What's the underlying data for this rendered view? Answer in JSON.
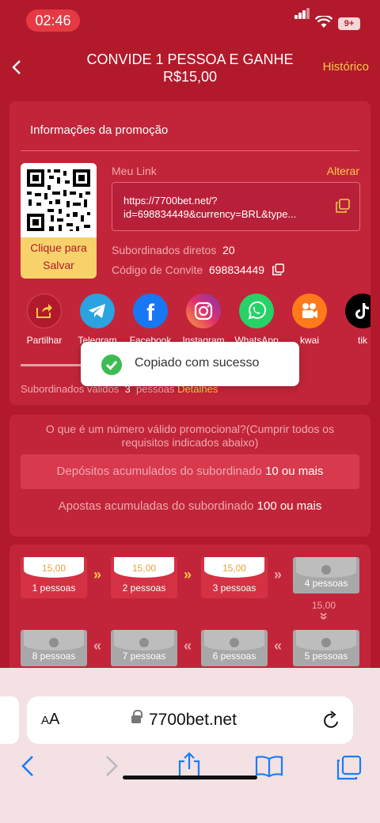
{
  "status": {
    "time": "02:46",
    "battery": "9+"
  },
  "header": {
    "title_line1": "CONVIDE 1 PESSOA E GANHE",
    "title_line2": "R$15,00",
    "history": "Histórico"
  },
  "promo": {
    "title": "Informações da promoção",
    "qr_label": "Clique para Salvar",
    "link_label": "Meu Link",
    "change": "Alterar",
    "link": "https://7700bet.net/?id=698834449&currency=BRL&type...",
    "direct_label": "Subordinados diretos",
    "direct_value": "20",
    "code_label": "Código de Convite",
    "code_value": "698834449",
    "valid_label": "Subordinados válidos",
    "valid_value": "3",
    "valid_unit": "pessoas",
    "details": "Detalhes"
  },
  "share": [
    {
      "label": "Partilhar",
      "icon": "share-icon",
      "color": "#b21a2b"
    },
    {
      "label": "Telegram",
      "icon": "telegram-icon",
      "color": "#2aa3e0"
    },
    {
      "label": "Facebook",
      "icon": "facebook-icon",
      "color": "#1877f2"
    },
    {
      "label": "Instagram",
      "icon": "instagram-icon",
      "color": "#d6249f"
    },
    {
      "label": "WhatsApp",
      "icon": "whatsapp-icon",
      "color": "#25d366"
    },
    {
      "label": "kwai",
      "icon": "kwai-icon",
      "color": "#ff7a1a"
    },
    {
      "label": "tik",
      "icon": "tiktok-icon",
      "color": "#000000"
    }
  ],
  "toast": {
    "text": "Copiado com sucesso"
  },
  "requirements": {
    "title": "O que é um número válido promocional?(Cumprir todos os requisitos indicados abaixo)",
    "row1_label": "Depósitos acumulados do subordinado",
    "row1_value": "10 ou mais",
    "row2_label": "Apostas acumuladas do subordinado",
    "row2_value": "100 ou mais"
  },
  "rewards": {
    "amount": "15,00",
    "levels": [
      "1 pessoas",
      "2 pessoas",
      "3 pessoas",
      "4 pessoas",
      "5 pessoas",
      "6 pessoas",
      "7 pessoas",
      "8 pessoas"
    ]
  },
  "browser": {
    "aa_small": "A",
    "aa_big": "A",
    "url": "7700bet.net"
  }
}
